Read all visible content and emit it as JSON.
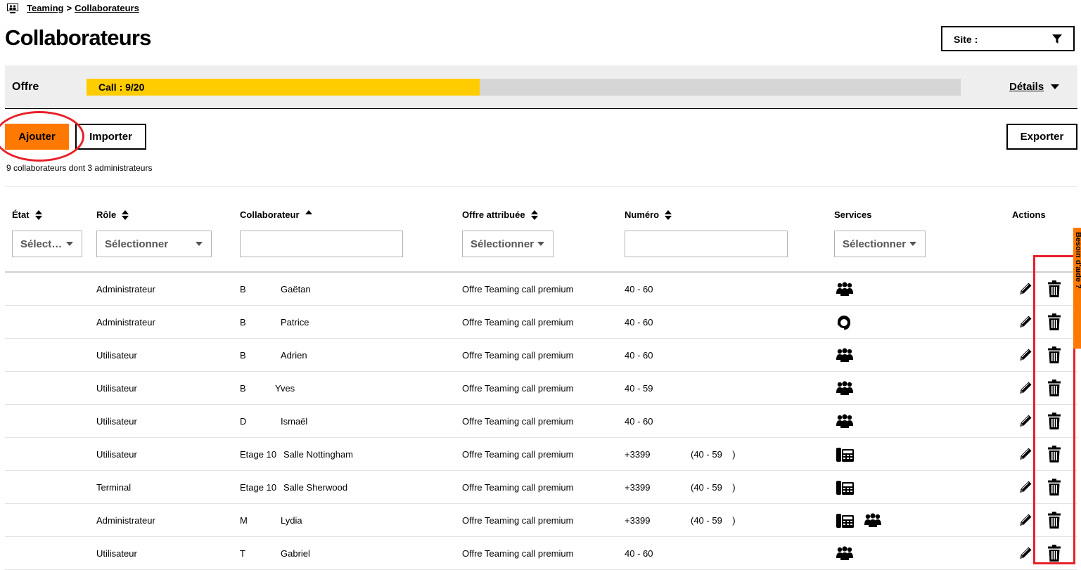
{
  "breadcrumb": {
    "root": "Teaming",
    "separator": ">",
    "current": "Collaborateurs"
  },
  "page": {
    "title": "Collaborateurs"
  },
  "site_filter": {
    "label": "Site :"
  },
  "offer": {
    "label": "Offre",
    "progress_text": "Call : 9/20",
    "used": 9,
    "total": 20,
    "details_label": "Détails"
  },
  "actions": {
    "add": "Ajouter",
    "import": "Importer",
    "export": "Exporter"
  },
  "summary": "9 collaborateurs dont 3 administrateurs",
  "columns": {
    "state": "État",
    "role": "Rôle",
    "collaborator": "Collaborateur",
    "offer": "Offre attribuée",
    "number": "Numéro",
    "services": "Services",
    "actions": "Actions"
  },
  "filters": {
    "state": "Sélect…",
    "role": "Sélectionner",
    "offer": "Sélectionner",
    "services": "Sélectionner"
  },
  "side_tab": {
    "label": "Besoin d'aide ?"
  },
  "rows": [
    {
      "role": "Administrateur",
      "initial": "B",
      "name": "Gaëtan",
      "offer": "Offre Teaming call premium",
      "number": "40 - 60",
      "number_detail": "",
      "services": [
        "group-icon"
      ]
    },
    {
      "role": "Administrateur",
      "initial": "B",
      "name": "Patrice",
      "offer": "Offre Teaming call premium",
      "number": "40 - 60",
      "number_detail": "",
      "services": [
        "headset-icon"
      ]
    },
    {
      "role": "Utilisateur",
      "initial": "B",
      "name": "Adrien",
      "offer": "Offre Teaming call premium",
      "number": "40 - 60",
      "number_detail": "",
      "services": [
        "group-icon"
      ]
    },
    {
      "role": "Utilisateur",
      "initial": "B",
      "name": "Yves",
      "offer": "Offre Teaming call premium",
      "number": "40 - 59",
      "number_detail": "",
      "services": [
        "group-icon"
      ]
    },
    {
      "role": "Utilisateur",
      "initial": "D",
      "name": "Ismaël",
      "offer": "Offre Teaming call premium",
      "number": "40 - 60",
      "number_detail": "",
      "services": [
        "group-icon"
      ]
    },
    {
      "role": "Utilisateur",
      "initial": "Etage 10",
      "name": "Salle Nottingham",
      "offer": "Offre Teaming call premium",
      "number": "+3399",
      "number_detail": "(40 - 59    )",
      "services": [
        "desk-phone-icon"
      ]
    },
    {
      "role": "Terminal",
      "initial": "Etage 10",
      "name": "Salle Sherwood",
      "offer": "Offre Teaming call premium",
      "number": "+3399",
      "number_detail": "(40 - 59    )",
      "services": [
        "desk-phone-icon"
      ]
    },
    {
      "role": "Administrateur",
      "initial": "M",
      "name": "Lydia",
      "offer": "Offre Teaming call premium",
      "number": "+3399",
      "number_detail": "(40 - 59    )",
      "services": [
        "desk-phone-icon",
        "group-icon"
      ]
    },
    {
      "role": "Utilisateur",
      "initial": "T",
      "name": "Gabriel",
      "offer": "Offre Teaming call premium",
      "number": "40 - 60",
      "number_detail": "",
      "services": [
        "group-icon"
      ]
    }
  ]
}
